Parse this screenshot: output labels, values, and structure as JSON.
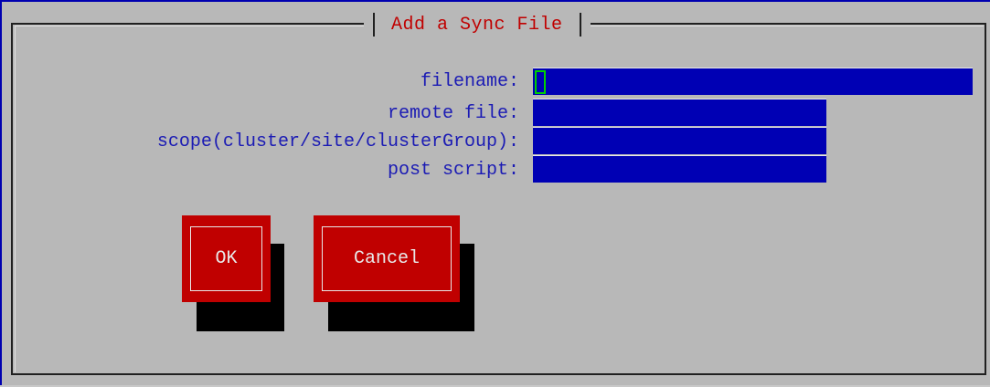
{
  "dialog": {
    "title": "Add a Sync File"
  },
  "form": {
    "fields": [
      {
        "label": "filename:",
        "value": ""
      },
      {
        "label": "remote file:",
        "value": ""
      },
      {
        "label": "scope(cluster/site/clusterGroup):",
        "value": ""
      },
      {
        "label": "post script:",
        "value": ""
      }
    ]
  },
  "buttons": {
    "ok": "OK",
    "cancel": "Cancel"
  },
  "colors": {
    "background": "#b8b8b8",
    "title_text": "#c00000",
    "label_text": "#1b1bb4",
    "field_fill": "#0000b4",
    "button_fill": "#c00000",
    "cursor": "#00d000"
  }
}
